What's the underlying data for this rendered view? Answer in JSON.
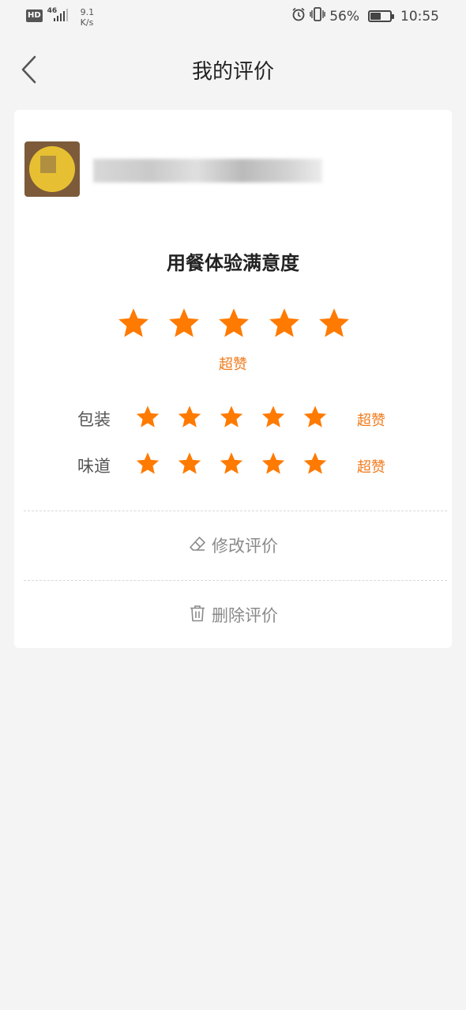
{
  "status_bar": {
    "hd_badge": "HD",
    "network_gen": "46",
    "speed_value": "9.1",
    "speed_unit": "K/s",
    "battery_percent": "56%",
    "battery_level": 0.56,
    "time": "10:55",
    "icons": [
      "alarm-icon",
      "vibrate-icon",
      "battery-icon",
      "signal-icon"
    ]
  },
  "nav": {
    "title": "我的评价",
    "back_icon": "chevron-left-icon"
  },
  "card": {
    "section_title": "用餐体验满意度",
    "overall_rating": {
      "stars": 5,
      "max": 5,
      "label": "超赞"
    },
    "sub_ratings": [
      {
        "label": "包装",
        "stars": 5,
        "max": 5,
        "rating_label": "超赞"
      },
      {
        "label": "味道",
        "stars": 5,
        "max": 5,
        "rating_label": "超赞"
      }
    ],
    "actions": {
      "edit_label": "修改评价",
      "edit_icon": "eraser-icon",
      "delete_label": "删除评价",
      "delete_icon": "trash-icon"
    }
  },
  "colors": {
    "accent": "#ff7a00",
    "label_accent": "#f07a1a",
    "background": "#f4f4f4",
    "card": "#ffffff"
  }
}
